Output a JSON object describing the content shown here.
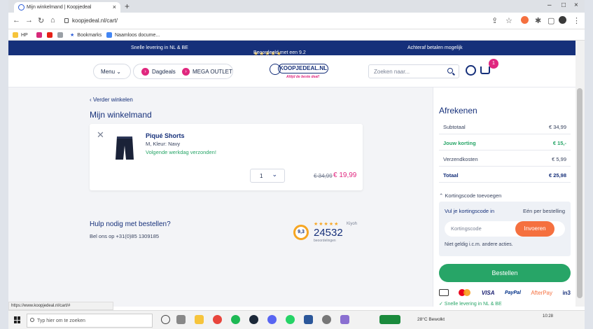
{
  "browser": {
    "tab_title": "Mijn winkelmand | Koopjedeal",
    "url": "koopjedeal.nl/cart/",
    "status_url": "https://www.koopjedeal.nl/cart/#",
    "bookmarks": [
      {
        "label": "HP",
        "icon": "folder-icon"
      },
      {
        "label": "",
        "icon": "instagram-icon"
      },
      {
        "label": "",
        "icon": "youtube-icon"
      },
      {
        "label": "",
        "icon": "image-icon"
      },
      {
        "label": "Bookmarks",
        "icon": "star-icon"
      },
      {
        "label": "Naamloos docume...",
        "icon": "docs-icon"
      }
    ]
  },
  "topstrip": {
    "left": "Snelle levering in NL & BE",
    "rating_stars": "★★★★★",
    "rating": "Beoordeeld met een 9.2",
    "right": "Achteraf betalen mogelijk"
  },
  "header": {
    "menu_label": "Menu",
    "dagdeals_label": "Dagdeals",
    "outlet_label": "MEGA OUTLET",
    "logo_text": "KOOPJEDEAL.NL",
    "logo_tagline": "Altijd de beste deal!",
    "search_placeholder": "Zoeken naar...",
    "cart_count": "1"
  },
  "cart": {
    "back_link": "Verder winkelen",
    "title": "Mijn winkelmand",
    "items": [
      {
        "name": "Piqué Shorts",
        "variant": "M, Kleur: Navy",
        "shipping": "Volgende werkdag verzonden!",
        "quantity": "1",
        "old_price": "€ 34,99",
        "price": "€ 19,99"
      }
    ]
  },
  "help": {
    "title": "Hulp nodig met bestellen?",
    "phone": "Bel ons op +31(0)85 1309185"
  },
  "kiyoh": {
    "score": "9,3",
    "stars": "★★★★★",
    "brand": "Kiyoh",
    "count": "24532",
    "label": "beoordelingen"
  },
  "checkout": {
    "title": "Afrekenen",
    "subtotal_label": "Subtotaal",
    "subtotal": "€ 34,99",
    "discount_label": "Jouw korting",
    "discount": "€ 15,-",
    "shipping_label": "Verzendkosten",
    "shipping": "€ 5,99",
    "total_label": "Totaal",
    "total": "€ 25,98",
    "coupon_toggle": "Kortingscode toevoegen",
    "coupon_title": "Vul je kortingscode in",
    "coupon_note": "Eén per bestelling",
    "coupon_placeholder": "Kortingscode",
    "coupon_apply": "Invoeren",
    "coupon_hint": "Niet geldig i.c.m. andere acties.",
    "order_button": "Bestellen",
    "payments": [
      "iDEAL",
      "Mastercard",
      "VISA",
      "PayPal",
      "AfterPay",
      "in3"
    ],
    "usp_partial": "✓ Snelle levering in NL & BE"
  },
  "taskbar": {
    "search_placeholder": "Typ hier om te zoeken",
    "weather": "28°C Bewolkt",
    "time": "10:28"
  },
  "colors": {
    "navy": "#16307a",
    "pink": "#e0277f",
    "green": "#27a567",
    "orange": "#f5703f"
  }
}
